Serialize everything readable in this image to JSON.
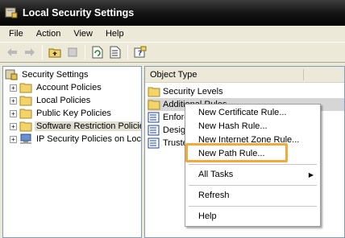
{
  "window": {
    "title": "Local Security Settings",
    "icon": "security-settings-icon"
  },
  "menu": [
    "File",
    "Action",
    "View",
    "Help"
  ],
  "toolbar": {
    "buttons": [
      "back-icon",
      "forward-icon",
      "up-folder-icon",
      "delete-icon",
      "refresh-icon",
      "export-list-icon",
      "help-icon"
    ]
  },
  "tree": {
    "root": "Security Settings",
    "items": [
      {
        "label": "Account Policies",
        "expander": "+"
      },
      {
        "label": "Local Policies",
        "expander": "+"
      },
      {
        "label": "Public Key Policies",
        "expander": "+"
      },
      {
        "label": "Software Restriction Policies",
        "expander": "+"
      },
      {
        "label": "IP Security Policies on Local Computer",
        "expander": "+"
      }
    ]
  },
  "list": {
    "header": "Object Type",
    "rows": [
      "Security Levels",
      "Additional Rules",
      "Enforcement",
      "Designated File Types",
      "Trusted Publishers"
    ]
  },
  "context_menu": {
    "items": [
      "New Certificate Rule...",
      "New Hash Rule...",
      "New Internet Zone Rule...",
      "New Path Rule...",
      "All Tasks",
      "Refresh",
      "Help"
    ],
    "highlight_color": "#f2a93b"
  }
}
